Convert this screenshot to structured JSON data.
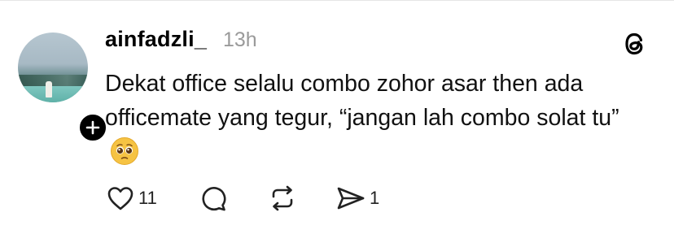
{
  "post": {
    "username": "ainfadzli_",
    "time": "13h",
    "text": "Dekat office selalu combo zohor asar then ada officemate yang tegur, “jangan lah combo solat tu”",
    "emoji_icon": "pleading-face-emoji"
  },
  "actions": {
    "like_count": "11",
    "share_count": "1"
  },
  "icons": {
    "app_logo": "threads-icon",
    "follow": "plus-icon",
    "like": "heart-icon",
    "comment": "comment-icon",
    "repost": "repost-icon",
    "share": "send-icon"
  }
}
